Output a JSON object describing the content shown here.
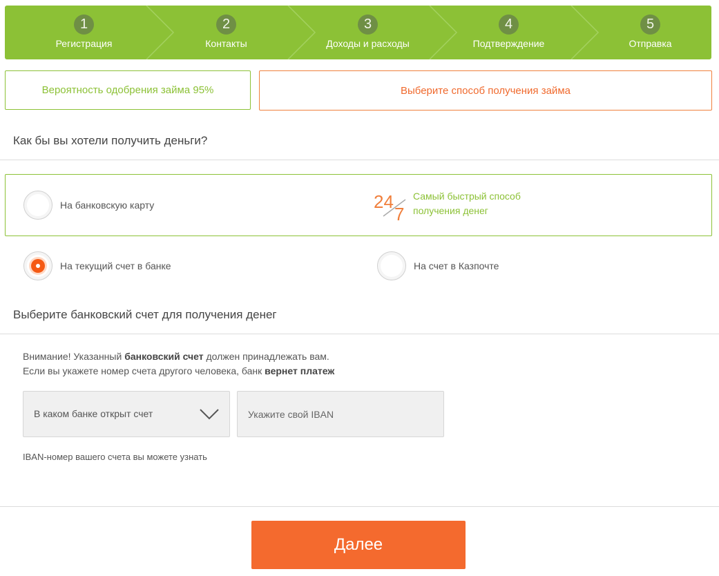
{
  "steps": [
    {
      "number": "1",
      "label": "Регистрация"
    },
    {
      "number": "2",
      "label": "Контакты"
    },
    {
      "number": "3",
      "label": "Доходы и расходы"
    },
    {
      "number": "4",
      "label": "Подтверждение"
    },
    {
      "number": "5",
      "label": "Отправка"
    }
  ],
  "approval": {
    "text": "Вероятность одобрения займа 95%"
  },
  "method_hint": {
    "text": "Выберите способ получения займа"
  },
  "question": {
    "title": "Как бы вы хотели получить деньги?"
  },
  "options": {
    "card": {
      "label": "На банковскую карту",
      "checked": false
    },
    "fast": {
      "icon": "24-7-icon",
      "line1": "Самый быстрый способ",
      "line2": "получения денег"
    },
    "account": {
      "label": "На текущий счет в банке",
      "checked": true
    },
    "kazpost": {
      "label": "На счет в Казпочте",
      "checked": false
    }
  },
  "bank_section": {
    "title": "Выберите банковский счет для получения денег",
    "notice_part1": "Внимание! Указанный ",
    "notice_bold1": "банковский счет",
    "notice_part2": " должен принадлежать вам.",
    "notice_line2": "Если вы укажете номер счета другого человека, банк ",
    "notice_bold2": "вернет платеж",
    "bank_select_placeholder": "В каком банке открыт счет",
    "iban_placeholder": "Укажите свой IBAN",
    "iban_hint": "IBAN-номер вашего счета вы можете узнать"
  },
  "next_button": {
    "label": "Далее"
  },
  "colors": {
    "green": "#8cc136",
    "orange": "#f46a2e"
  }
}
